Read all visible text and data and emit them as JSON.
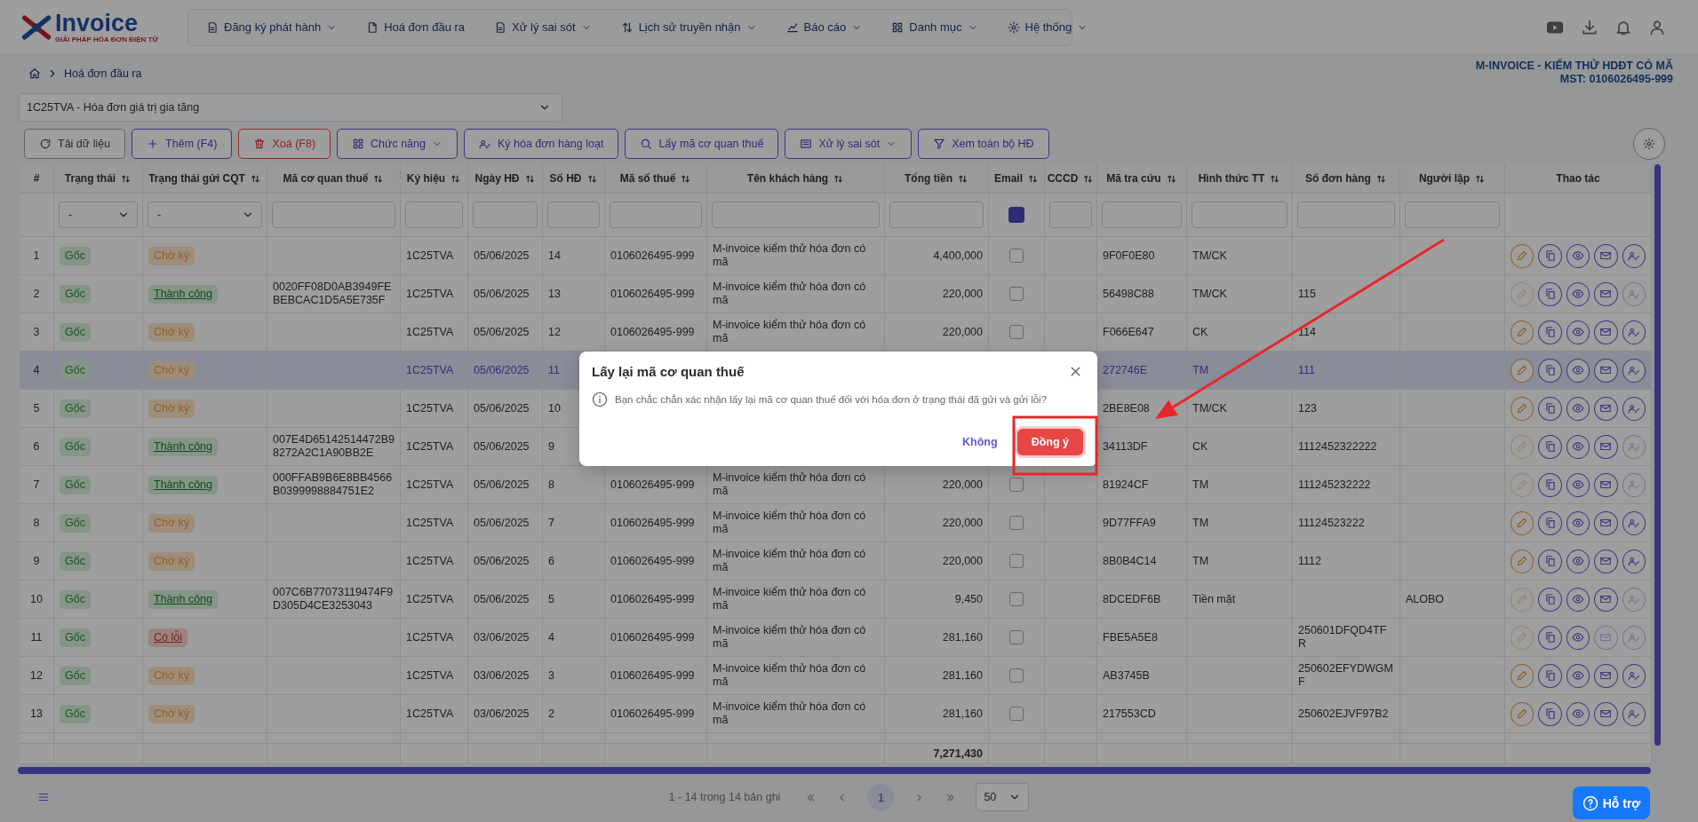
{
  "header": {
    "logo": {
      "name": "Invoice",
      "tagline": "GIẢI PHÁP HÓA ĐƠN ĐIỆN TỬ"
    },
    "nav": [
      {
        "label": "Đăng ký phát hành",
        "has_menu": true
      },
      {
        "label": "Hoá đơn đầu ra",
        "has_menu": false
      },
      {
        "label": "Xử lý sai sót",
        "has_menu": true
      },
      {
        "label": "Lịch sử truyền nhận",
        "has_menu": true
      },
      {
        "label": "Báo cáo",
        "has_menu": true
      },
      {
        "label": "Danh mục",
        "has_menu": true
      },
      {
        "label": "Hệ thống",
        "has_menu": true
      }
    ]
  },
  "breadcrumb": {
    "current": "Hoá đơn đầu ra"
  },
  "company": {
    "name": "M-INVOICE - KIỂM THỬ HDĐT CÓ MÃ",
    "tax_code": "MST: 0106026495-999"
  },
  "invoice_type": {
    "value": "1C25TVA - Hóa đơn giá trị gia tăng"
  },
  "toolbar": [
    {
      "label": "Tải dữ liệu",
      "kind": "default",
      "has_menu": false
    },
    {
      "label": "Thêm (F4)",
      "kind": "primary",
      "has_menu": false
    },
    {
      "label": "Xoá (F8)",
      "kind": "danger",
      "has_menu": false
    },
    {
      "label": "Chức năng",
      "kind": "primary",
      "has_menu": true
    },
    {
      "label": "Ký hóa đơn hàng loạt",
      "kind": "primary",
      "has_menu": false
    },
    {
      "label": "Lấy mã cơ quan thuế",
      "kind": "primary",
      "has_menu": false
    },
    {
      "label": "Xử lý sai sót",
      "kind": "primary",
      "has_menu": true
    },
    {
      "label": "Xem toàn bộ HĐ",
      "kind": "primary",
      "has_menu": false
    }
  ],
  "table": {
    "columns": [
      {
        "label": "#",
        "sortable": false
      },
      {
        "label": "Trạng thái",
        "sortable": true,
        "filter": {
          "kind": "select",
          "value": "-"
        }
      },
      {
        "label": "Trạng thái gửi CQT",
        "sortable": true,
        "filter": {
          "kind": "select",
          "value": "-"
        }
      },
      {
        "label": "Mã cơ quan thuế",
        "sortable": true,
        "filter": {
          "kind": "input"
        }
      },
      {
        "label": "Ký hiệu",
        "sortable": true,
        "filter": {
          "kind": "input"
        }
      },
      {
        "label": "Ngày HĐ",
        "sortable": true,
        "filter": {
          "kind": "input"
        }
      },
      {
        "label": "Số HĐ",
        "sortable": true,
        "filter": {
          "kind": "input"
        }
      },
      {
        "label": "Mã số thuế",
        "sortable": true,
        "filter": {
          "kind": "input"
        }
      },
      {
        "label": "Tên khách hàng",
        "sortable": true,
        "filter": {
          "kind": "input"
        }
      },
      {
        "label": "Tổng tiền",
        "sortable": true,
        "filter": {
          "kind": "input"
        }
      },
      {
        "label": "Email",
        "sortable": true,
        "filter": {
          "kind": "checkbox",
          "checked": true
        }
      },
      {
        "label": "CCCD",
        "sortable": true,
        "filter": {
          "kind": "input"
        }
      },
      {
        "label": "Mã tra cứu",
        "sortable": true,
        "filter": {
          "kind": "input"
        }
      },
      {
        "label": "Hình thức TT",
        "sortable": true,
        "filter": {
          "kind": "input"
        }
      },
      {
        "label": "Số đơn hàng",
        "sortable": true,
        "filter": {
          "kind": "input"
        }
      },
      {
        "label": "Người lập",
        "sortable": true,
        "filter": {
          "kind": "input"
        }
      },
      {
        "label": "Thao tác",
        "sortable": false
      }
    ],
    "rows": [
      {
        "no": "1",
        "origin": "Gốc",
        "cqt_status": {
          "label": "Chờ ký",
          "kind": "pending"
        },
        "symbol": "1C25TVA",
        "date": "05/06/2025",
        "number": "14",
        "buyer_tax_code": "0106026495-999",
        "customer": "M-invoice kiểm thử hóa đơn có mã",
        "total": "4,400,000",
        "email": false,
        "lookup_code": "9F0F0E80",
        "payment": "TM/CK",
        "can_edit": true,
        "can_email": true,
        "can_sign": true,
        "selected": false
      },
      {
        "no": "2",
        "origin": "Gốc",
        "cqt_status": {
          "label": "Thành công",
          "kind": "success"
        },
        "tax_authority_code": "0020FF08D0AB3949FEBEBCAC1D5A5E735F",
        "symbol": "1C25TVA",
        "date": "05/06/2025",
        "number": "13",
        "buyer_tax_code": "0106026495-999",
        "customer": "M-invoice kiểm thử hóa đơn có mã",
        "total": "220,000",
        "email": false,
        "lookup_code": "56498C88",
        "payment": "TM/CK",
        "order_no": "115",
        "can_edit": false,
        "can_email": true,
        "can_sign": false,
        "selected": false
      },
      {
        "no": "3",
        "origin": "Gốc",
        "cqt_status": {
          "label": "Chờ ký",
          "kind": "pending"
        },
        "symbol": "1C25TVA",
        "date": "05/06/2025",
        "number": "12",
        "buyer_tax_code": "0106026495-999",
        "customer": "M-invoice kiểm thử hóa đơn có mã",
        "total": "220,000",
        "email": false,
        "lookup_code": "F066E647",
        "payment": "CK",
        "order_no": "114",
        "can_edit": true,
        "can_email": true,
        "can_sign": true,
        "selected": false
      },
      {
        "no": "4",
        "origin": "Gốc",
        "cqt_status": {
          "label": "Chờ ký",
          "kind": "pending"
        },
        "symbol": "1C25TVA",
        "date": "05/06/2025",
        "number": "11",
        "lookup_code": "272746E",
        "payment": "TM",
        "order_no": "111",
        "can_edit": true,
        "can_email": true,
        "can_sign": true,
        "selected": true
      },
      {
        "no": "5",
        "origin": "Gốc",
        "cqt_status": {
          "label": "Chờ ký",
          "kind": "pending"
        },
        "symbol": "1C25TVA",
        "date": "05/06/2025",
        "number": "10",
        "lookup_code": "2BE8E08",
        "payment": "TM/CK",
        "order_no": "123",
        "can_edit": true,
        "can_email": true,
        "can_sign": true,
        "selected": false
      },
      {
        "no": "6",
        "origin": "Gốc",
        "cqt_status": {
          "label": "Thành công",
          "kind": "success"
        },
        "tax_authority_code": "007E4D65142514472B98272A2C1A90BB2E",
        "symbol": "1C25TVA",
        "date": "05/06/2025",
        "number": "9",
        "lookup_code": "34113DF",
        "payment": "CK",
        "order_no": "1112452322222",
        "can_edit": false,
        "can_email": true,
        "can_sign": false,
        "selected": false
      },
      {
        "no": "7",
        "origin": "Gốc",
        "cqt_status": {
          "label": "Thành công",
          "kind": "success"
        },
        "tax_authority_code": "000FFAB9B6E8BB4566B0399998884751E2",
        "symbol": "1C25TVA",
        "date": "05/06/2025",
        "number": "8",
        "buyer_tax_code": "0106026495-999",
        "customer": "M-invoice kiểm thử hóa đơn có mã",
        "total": "220,000",
        "email": false,
        "lookup_code": "81924CF",
        "payment": "TM",
        "order_no": "111245232222",
        "can_edit": false,
        "can_email": true,
        "can_sign": false,
        "selected": false
      },
      {
        "no": "8",
        "origin": "Gốc",
        "cqt_status": {
          "label": "Chờ ký",
          "kind": "pending"
        },
        "symbol": "1C25TVA",
        "date": "05/06/2025",
        "number": "7",
        "buyer_tax_code": "0106026495-999",
        "customer": "M-invoice kiểm thử hóa đơn có mã",
        "total": "220,000",
        "email": false,
        "lookup_code": "9D77FFA9",
        "payment": "TM",
        "order_no": "11124523222",
        "can_edit": true,
        "can_email": true,
        "can_sign": true,
        "selected": false
      },
      {
        "no": "9",
        "origin": "Gốc",
        "cqt_status": {
          "label": "Chờ ký",
          "kind": "pending"
        },
        "symbol": "1C25TVA",
        "date": "05/06/2025",
        "number": "6",
        "buyer_tax_code": "0106026495-999",
        "customer": "M-invoice kiểm thử hóa đơn có mã",
        "total": "220,000",
        "email": false,
        "lookup_code": "8B0B4C14",
        "payment": "TM",
        "order_no": "1112",
        "can_edit": true,
        "can_email": true,
        "can_sign": true,
        "selected": false
      },
      {
        "no": "10",
        "origin": "Gốc",
        "cqt_status": {
          "label": "Thành công",
          "kind": "success"
        },
        "tax_authority_code": "007C6B77073119474F9D305D4CE3253043",
        "symbol": "1C25TVA",
        "date": "05/06/2025",
        "number": "5",
        "buyer_tax_code": "0106026495-999",
        "customer": "M-invoice kiểm thử hóa đơn có mã",
        "total": "9,450",
        "email": false,
        "lookup_code": "8DCEDF6B",
        "payment": "Tiền mặt",
        "creator": "ALOBO",
        "can_edit": false,
        "can_email": true,
        "can_sign": false,
        "selected": false
      },
      {
        "no": "11",
        "origin": "Gốc",
        "cqt_status": {
          "label": "Có lỗi",
          "kind": "error"
        },
        "symbol": "1C25TVA",
        "date": "03/06/2025",
        "number": "4",
        "buyer_tax_code": "0106026495-999",
        "customer": "M-invoice kiểm thử hóa đơn có mã",
        "total": "281,160",
        "email": false,
        "lookup_code": "FBE5A5E8",
        "order_no": "250601DFQD4TFR",
        "can_edit": false,
        "can_email": false,
        "can_sign": false,
        "selected": false
      },
      {
        "no": "12",
        "origin": "Gốc",
        "cqt_status": {
          "label": "Chờ ký",
          "kind": "pending"
        },
        "symbol": "1C25TVA",
        "date": "03/06/2025",
        "number": "3",
        "buyer_tax_code": "0106026495-999",
        "customer": "M-invoice kiểm thử hóa đơn có mã",
        "total": "281,160",
        "email": false,
        "lookup_code": "AB3745B",
        "order_no": "250602EFYDWGMF",
        "can_edit": true,
        "can_email": true,
        "can_sign": true,
        "selected": false
      },
      {
        "no": "13",
        "origin": "Gốc",
        "cqt_status": {
          "label": "Chờ ký",
          "kind": "pending"
        },
        "symbol": "1C25TVA",
        "date": "03/06/2025",
        "number": "2",
        "buyer_tax_code": "0106026495-999",
        "customer": "M-invoice kiểm thử hóa đơn có mã",
        "total": "281,160",
        "email": false,
        "lookup_code": "217553CD",
        "order_no": "250602EJVF97B2",
        "can_edit": true,
        "can_email": true,
        "can_sign": true,
        "selected": false
      }
    ],
    "total": "7,271,430"
  },
  "pagination": {
    "summary": "1 - 14 trong 14 bản ghi",
    "pages": [
      {
        "label": "1",
        "selected": true
      }
    ],
    "page_size": "50"
  },
  "dialog": {
    "title": "Lấy lại mã cơ quan thuế",
    "message": "Bạn chắc chắn xác nhận lấy lại mã cơ quan thuế đối với hóa đơn ở trạng thái đã gửi và gửi lỗi?",
    "buttons": [
      {
        "label": "Không",
        "kind": "link"
      },
      {
        "label": "Đồng ý",
        "kind": "danger"
      }
    ]
  },
  "help_button": {
    "label": "Hỗ trợ"
  }
}
